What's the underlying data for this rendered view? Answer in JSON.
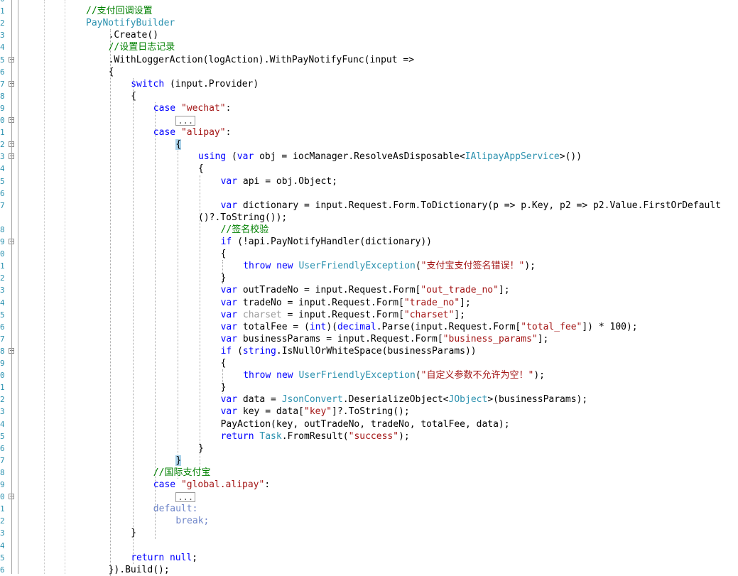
{
  "code": {
    "line_numbers": [
      "0",
      "1",
      "2",
      "3",
      "4",
      "5",
      "6",
      "7",
      "8",
      "9",
      "0",
      "1",
      "2",
      "3",
      "4",
      "5",
      "6",
      "7",
      "",
      "8",
      "9",
      "0",
      "1",
      "2",
      "3",
      "4",
      "5",
      "6",
      "7",
      "8",
      "9",
      "0",
      "1",
      "2",
      "3",
      "4",
      "5",
      "6",
      "7",
      "8",
      "9",
      "0",
      "1",
      "2",
      "3",
      "4",
      "5",
      "6"
    ],
    "lines": [
      {
        "indent": 0,
        "tokens": [
          {
            "t": "",
            "c": ""
          }
        ]
      },
      {
        "indent": 0,
        "tokens": [
          {
            "t": "//支付回调设置",
            "c": "cmt"
          }
        ]
      },
      {
        "indent": 0,
        "tokens": [
          {
            "t": "PayNotifyBuilder",
            "c": "typ"
          }
        ]
      },
      {
        "indent": 1,
        "tokens": [
          {
            "t": ".Create()",
            "c": ""
          }
        ]
      },
      {
        "indent": 1,
        "tokens": [
          {
            "t": "//设置日志记录",
            "c": "cmt"
          }
        ]
      },
      {
        "indent": 1,
        "tokens": [
          {
            "t": ".WithLoggerAction(logAction).WithPayNotifyFunc(input =>",
            "c": ""
          }
        ]
      },
      {
        "indent": 1,
        "tokens": [
          {
            "t": "{",
            "c": ""
          }
        ]
      },
      {
        "indent": 2,
        "tokens": [
          {
            "t": "switch",
            "c": "kw"
          },
          {
            "t": " (input.Provider)",
            "c": ""
          }
        ]
      },
      {
        "indent": 2,
        "tokens": [
          {
            "t": "{",
            "c": ""
          }
        ]
      },
      {
        "indent": 3,
        "tokens": [
          {
            "t": "case",
            "c": "kw"
          },
          {
            "t": " ",
            "c": ""
          },
          {
            "t": "\"wechat\"",
            "c": "str"
          },
          {
            "t": ":",
            "c": ""
          }
        ]
      },
      {
        "indent": 4,
        "tokens": [
          {
            "t": "...",
            "c": "collapsed"
          }
        ]
      },
      {
        "indent": 3,
        "tokens": [
          {
            "t": "case",
            "c": "kw"
          },
          {
            "t": " ",
            "c": ""
          },
          {
            "t": "\"alipay\"",
            "c": "str"
          },
          {
            "t": ":",
            "c": ""
          }
        ]
      },
      {
        "indent": 4,
        "tokens": [
          {
            "t": "{",
            "c": "brace-hl"
          }
        ]
      },
      {
        "indent": 5,
        "tokens": [
          {
            "t": "using",
            "c": "kw"
          },
          {
            "t": " (",
            "c": ""
          },
          {
            "t": "var",
            "c": "kw"
          },
          {
            "t": " obj = iocManager.ResolveAsDisposable<",
            "c": ""
          },
          {
            "t": "IAlipayAppService",
            "c": "typ"
          },
          {
            "t": ">())",
            "c": ""
          }
        ]
      },
      {
        "indent": 5,
        "tokens": [
          {
            "t": "{",
            "c": ""
          }
        ]
      },
      {
        "indent": 6,
        "tokens": [
          {
            "t": "var",
            "c": "kw"
          },
          {
            "t": " api = obj.Object;",
            "c": ""
          }
        ]
      },
      {
        "indent": 6,
        "tokens": [
          {
            "t": "",
            "c": ""
          }
        ]
      },
      {
        "indent": 6,
        "tokens": [
          {
            "t": "var",
            "c": "kw"
          },
          {
            "t": " dictionary = input.Request.Form.ToDictionary(p => p.Key, p2 => p2.Value.FirstOrDefault",
            "c": ""
          }
        ]
      },
      {
        "indent": 5,
        "tokens": [
          {
            "t": "()?.ToString());",
            "c": ""
          }
        ]
      },
      {
        "indent": 6,
        "tokens": [
          {
            "t": "//签名校验",
            "c": "cmt"
          }
        ]
      },
      {
        "indent": 6,
        "tokens": [
          {
            "t": "if",
            "c": "kw"
          },
          {
            "t": " (!api.PayNotifyHandler(dictionary))",
            "c": ""
          }
        ]
      },
      {
        "indent": 6,
        "tokens": [
          {
            "t": "{",
            "c": ""
          }
        ]
      },
      {
        "indent": 7,
        "tokens": [
          {
            "t": "throw",
            "c": "kw"
          },
          {
            "t": " ",
            "c": ""
          },
          {
            "t": "new",
            "c": "kw"
          },
          {
            "t": " ",
            "c": ""
          },
          {
            "t": "UserFriendlyException",
            "c": "typ"
          },
          {
            "t": "(",
            "c": ""
          },
          {
            "t": "\"支付宝支付签名错误！\"",
            "c": "str"
          },
          {
            "t": ");",
            "c": ""
          }
        ]
      },
      {
        "indent": 6,
        "tokens": [
          {
            "t": "}",
            "c": ""
          }
        ]
      },
      {
        "indent": 6,
        "tokens": [
          {
            "t": "var",
            "c": "kw"
          },
          {
            "t": " outTradeNo = input.Request.Form[",
            "c": ""
          },
          {
            "t": "\"out_trade_no\"",
            "c": "str"
          },
          {
            "t": "];",
            "c": ""
          }
        ]
      },
      {
        "indent": 6,
        "tokens": [
          {
            "t": "var",
            "c": "kw"
          },
          {
            "t": " tradeNo = input.Request.Form[",
            "c": ""
          },
          {
            "t": "\"trade_no\"",
            "c": "str"
          },
          {
            "t": "];",
            "c": ""
          }
        ]
      },
      {
        "indent": 6,
        "tokens": [
          {
            "t": "var",
            "c": "kw"
          },
          {
            "t": " ",
            "c": ""
          },
          {
            "t": "charset",
            "c": "dim"
          },
          {
            "t": " = input.Request.Form[",
            "c": ""
          },
          {
            "t": "\"charset\"",
            "c": "str"
          },
          {
            "t": "];",
            "c": ""
          }
        ]
      },
      {
        "indent": 6,
        "tokens": [
          {
            "t": "var",
            "c": "kw"
          },
          {
            "t": " totalFee = (",
            "c": ""
          },
          {
            "t": "int",
            "c": "kw"
          },
          {
            "t": ")(",
            "c": ""
          },
          {
            "t": "decimal",
            "c": "kw"
          },
          {
            "t": ".Parse(input.Request.Form[",
            "c": ""
          },
          {
            "t": "\"total_fee\"",
            "c": "str"
          },
          {
            "t": "]) * 100);",
            "c": ""
          }
        ]
      },
      {
        "indent": 6,
        "tokens": [
          {
            "t": "var",
            "c": "kw"
          },
          {
            "t": " businessParams = input.Request.Form[",
            "c": ""
          },
          {
            "t": "\"business_params\"",
            "c": "str"
          },
          {
            "t": "];",
            "c": ""
          }
        ]
      },
      {
        "indent": 6,
        "tokens": [
          {
            "t": "if",
            "c": "kw"
          },
          {
            "t": " (",
            "c": ""
          },
          {
            "t": "string",
            "c": "kw"
          },
          {
            "t": ".IsNullOrWhiteSpace(businessParams))",
            "c": ""
          }
        ]
      },
      {
        "indent": 6,
        "tokens": [
          {
            "t": "{",
            "c": ""
          }
        ]
      },
      {
        "indent": 7,
        "tokens": [
          {
            "t": "throw",
            "c": "kw"
          },
          {
            "t": " ",
            "c": ""
          },
          {
            "t": "new",
            "c": "kw"
          },
          {
            "t": " ",
            "c": ""
          },
          {
            "t": "UserFriendlyException",
            "c": "typ"
          },
          {
            "t": "(",
            "c": ""
          },
          {
            "t": "\"自定义参数不允许为空！\"",
            "c": "str"
          },
          {
            "t": ");",
            "c": ""
          }
        ]
      },
      {
        "indent": 6,
        "tokens": [
          {
            "t": "}",
            "c": ""
          }
        ]
      },
      {
        "indent": 6,
        "tokens": [
          {
            "t": "var",
            "c": "kw"
          },
          {
            "t": " data = ",
            "c": ""
          },
          {
            "t": "JsonConvert",
            "c": "typ"
          },
          {
            "t": ".DeserializeObject<",
            "c": ""
          },
          {
            "t": "JObject",
            "c": "typ"
          },
          {
            "t": ">(businessParams);",
            "c": ""
          }
        ]
      },
      {
        "indent": 6,
        "tokens": [
          {
            "t": "var",
            "c": "kw"
          },
          {
            "t": " key = data[",
            "c": ""
          },
          {
            "t": "\"key\"",
            "c": "str"
          },
          {
            "t": "]?.ToString();",
            "c": ""
          }
        ]
      },
      {
        "indent": 6,
        "tokens": [
          {
            "t": "PayAction(key, outTradeNo, tradeNo, totalFee, data);",
            "c": ""
          }
        ]
      },
      {
        "indent": 6,
        "tokens": [
          {
            "t": "return",
            "c": "kw"
          },
          {
            "t": " ",
            "c": ""
          },
          {
            "t": "Task",
            "c": "typ"
          },
          {
            "t": ".FromResult(",
            "c": ""
          },
          {
            "t": "\"success\"",
            "c": "str"
          },
          {
            "t": ");",
            "c": ""
          }
        ]
      },
      {
        "indent": 5,
        "tokens": [
          {
            "t": "}",
            "c": ""
          }
        ]
      },
      {
        "indent": 4,
        "tokens": [
          {
            "t": "}",
            "c": "brace-hl"
          }
        ]
      },
      {
        "indent": 3,
        "tokens": [
          {
            "t": "//国际支付宝",
            "c": "cmt"
          }
        ]
      },
      {
        "indent": 3,
        "tokens": [
          {
            "t": "case",
            "c": "kw"
          },
          {
            "t": " ",
            "c": ""
          },
          {
            "t": "\"global.alipay\"",
            "c": "str"
          },
          {
            "t": ":",
            "c": ""
          }
        ]
      },
      {
        "indent": 4,
        "tokens": [
          {
            "t": "...",
            "c": "collapsed"
          }
        ]
      },
      {
        "indent": 3,
        "tokens": [
          {
            "t": "default",
            "c": "kwd"
          },
          {
            "t": ":",
            "c": "kwd"
          }
        ]
      },
      {
        "indent": 4,
        "tokens": [
          {
            "t": "break",
            "c": "kwd"
          },
          {
            "t": ";",
            "c": "kwd"
          }
        ]
      },
      {
        "indent": 2,
        "tokens": [
          {
            "t": "}",
            "c": ""
          }
        ]
      },
      {
        "indent": 2,
        "tokens": [
          {
            "t": "",
            "c": ""
          }
        ]
      },
      {
        "indent": 2,
        "tokens": [
          {
            "t": "return",
            "c": "kw"
          },
          {
            "t": " ",
            "c": ""
          },
          {
            "t": "null",
            "c": "kw"
          },
          {
            "t": ";",
            "c": ""
          }
        ]
      },
      {
        "indent": 1,
        "tokens": [
          {
            "t": "}).Build();",
            "c": ""
          }
        ]
      }
    ],
    "fold_markers": [
      {
        "line": 5,
        "state": "expanded"
      },
      {
        "line": 7,
        "state": "expanded"
      },
      {
        "line": 10,
        "state": "collapsed"
      },
      {
        "line": 12,
        "state": "expanded"
      },
      {
        "line": 13,
        "state": "expanded"
      },
      {
        "line": 20,
        "state": "expanded"
      },
      {
        "line": 29,
        "state": "expanded"
      },
      {
        "line": 41,
        "state": "collapsed"
      }
    ]
  }
}
